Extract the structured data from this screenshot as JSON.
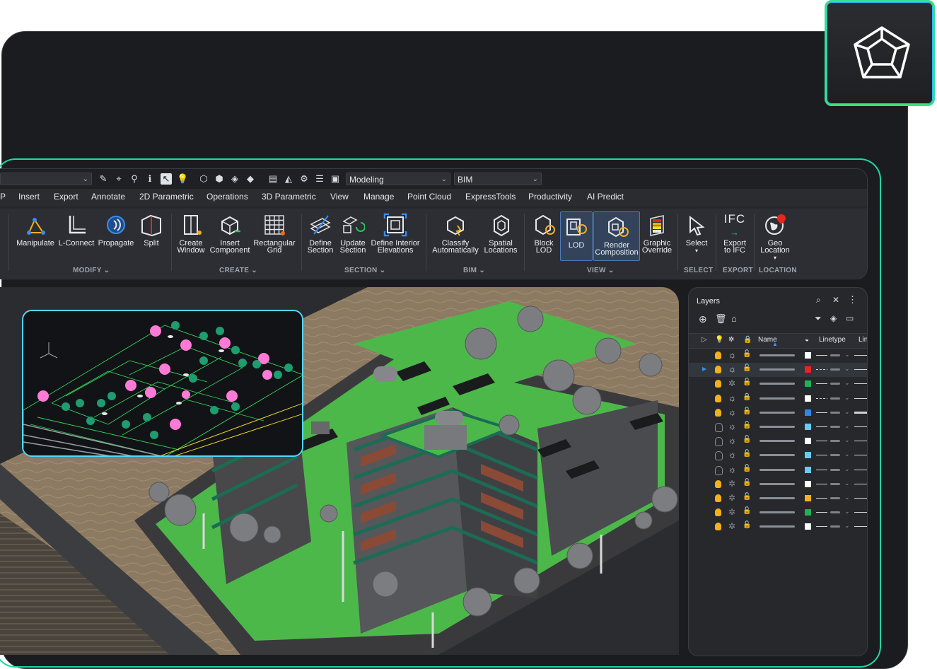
{
  "toolbar": {
    "workspace_combo": "Modeling",
    "profile_combo": "BIM"
  },
  "menu": [
    "P",
    "Insert",
    "Export",
    "Annotate",
    "2D Parametric",
    "Operations",
    "3D Parametric",
    "View",
    "Manage",
    "Point Cloud",
    "ExpressTools",
    "Productivity",
    "AI Predict"
  ],
  "ribbon": {
    "tools": [
      {
        "id": "manipulate",
        "l1": "Manipulate",
        "l2": ""
      },
      {
        "id": "l-connect",
        "l1": "L-Connect",
        "l2": ""
      },
      {
        "id": "propagate",
        "l1": "Propagate",
        "l2": ""
      },
      {
        "id": "split",
        "l1": "Split",
        "l2": ""
      },
      {
        "id": "create-window",
        "l1": "Create",
        "l2": "Window"
      },
      {
        "id": "insert-component",
        "l1": "Insert",
        "l2": "Component"
      },
      {
        "id": "rectangular-grid",
        "l1": "Rectangular",
        "l2": "Grid"
      },
      {
        "id": "define-section",
        "l1": "Define",
        "l2": "Section"
      },
      {
        "id": "update-section",
        "l1": "Update",
        "l2": "Section"
      },
      {
        "id": "define-interior-elevations",
        "l1": "Define Interior",
        "l2": "Elevations"
      },
      {
        "id": "classify-automatically",
        "l1": "Classify",
        "l2": "Automatically"
      },
      {
        "id": "spatial-locations",
        "l1": "Spatial",
        "l2": "Locations"
      },
      {
        "id": "block-lod",
        "l1": "Block",
        "l2": "LOD"
      },
      {
        "id": "lod",
        "l1": "LOD",
        "l2": ""
      },
      {
        "id": "render-composition",
        "l1": "Render",
        "l2": "Composition"
      },
      {
        "id": "graphic-override",
        "l1": "Graphic",
        "l2": "Override"
      },
      {
        "id": "select",
        "l1": "Select",
        "l2": ""
      },
      {
        "id": "export-to-ifc",
        "l1": "Export",
        "l2": "to IFC"
      },
      {
        "id": "geo-location",
        "l1": "Geo",
        "l2": "Location"
      }
    ],
    "groups": [
      "MODIFY",
      "CREATE",
      "SECTION",
      "BIM",
      "VIEW",
      "SELECT",
      "EXPORT",
      "LOCATION"
    ],
    "ifc_icon_text": "IFC"
  },
  "layers_panel": {
    "title": "Layers",
    "col_name": "Name",
    "col_linetype": "Linetype",
    "col_lineweight": "Lin",
    "rows": [
      {
        "color": "#ffffff",
        "bulb_on": true,
        "frozen": false,
        "locked": false,
        "linetype": "solid",
        "selected": false
      },
      {
        "color": "#e8251f",
        "bulb_on": true,
        "frozen": false,
        "locked": false,
        "linetype": "dashed",
        "selected": true
      },
      {
        "color": "#1fb254",
        "bulb_on": true,
        "frozen": true,
        "locked": false,
        "linetype": "solid",
        "selected": false
      },
      {
        "color": "#ffffff",
        "bulb_on": true,
        "frozen": false,
        "locked": true,
        "linetype": "dashed",
        "selected": false
      },
      {
        "color": "#2f86e6",
        "bulb_on": true,
        "frozen": false,
        "locked": false,
        "linetype": "solid",
        "selected": false
      },
      {
        "color": "#6cc8f2",
        "bulb_on": false,
        "frozen": false,
        "locked": false,
        "linetype": "solid",
        "selected": false
      },
      {
        "color": "#ffffff",
        "bulb_on": false,
        "frozen": false,
        "locked": false,
        "linetype": "solid",
        "selected": false
      },
      {
        "color": "#6cc8f2",
        "bulb_on": false,
        "frozen": false,
        "locked": false,
        "linetype": "solid",
        "selected": false
      },
      {
        "color": "#6cc8f2",
        "bulb_on": false,
        "frozen": false,
        "locked": false,
        "linetype": "solid",
        "selected": false
      },
      {
        "color": "#ffffff",
        "bulb_on": true,
        "frozen": true,
        "locked": false,
        "linetype": "solid",
        "selected": false
      },
      {
        "color": "#f2b01a",
        "bulb_on": true,
        "frozen": true,
        "locked": false,
        "linetype": "solid",
        "selected": false
      },
      {
        "color": "#1fb254",
        "bulb_on": true,
        "frozen": true,
        "locked": false,
        "linetype": "solid",
        "selected": false
      },
      {
        "color": "#ffffff",
        "bulb_on": true,
        "frozen": true,
        "locked": false,
        "linetype": "solid",
        "selected": false
      }
    ]
  },
  "colors": {
    "accent_green": "#38e08a",
    "accent_cyan": "#4fd8ff",
    "app_bg": "#26282c"
  }
}
